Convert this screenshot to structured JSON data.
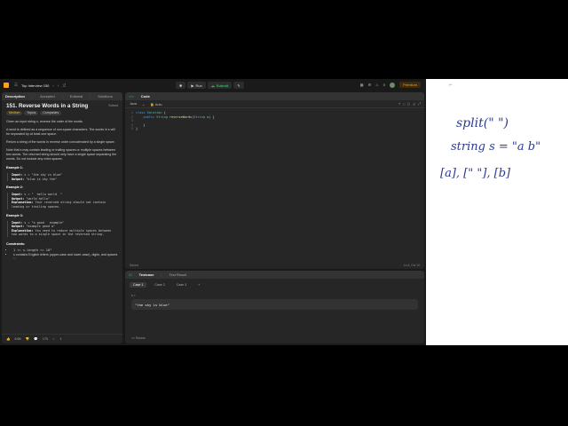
{
  "topbar": {
    "list_name": "Top Interview 150",
    "run_label": "Run",
    "submit_label": "Submit",
    "streak": "0",
    "premium_label": "Premium"
  },
  "desc_panel": {
    "tabs": [
      "Description",
      "Accepted",
      "Editorial",
      "Solutions"
    ],
    "title": "151. Reverse Words in a String",
    "solved": "Solved",
    "difficulty": "Medium",
    "topics": "Topics",
    "companies": "Companies",
    "p1": "Given an input string s, reverse the order of the words.",
    "p2": "A word is defined as a sequence of non-space characters. The words in s will be separated by at least one space.",
    "p3": "Return a string of the words in reverse order concatenated by a single space.",
    "p4": "Note that s may contain leading or trailing spaces or multiple spaces between two words. The returned string should only have a single space separating the words. Do not include any extra spaces.",
    "examples": [
      {
        "title": "Example 1:",
        "input": "s = \"the sky is blue\"",
        "output": "\"blue is sky the\"",
        "explanation": ""
      },
      {
        "title": "Example 2:",
        "input": "s = \"  hello world  \"",
        "output": "\"world hello\"",
        "explanation": "Your reversed string should not contain leading or trailing spaces."
      },
      {
        "title": "Example 3:",
        "input": "s = \"a good   example\"",
        "output": "\"example good a\"",
        "explanation": "You need to reduce multiple spaces between two words to a single space in the reversed string."
      }
    ],
    "input_key": "Input:",
    "output_key": "Output:",
    "explanation_key": "Explanation:",
    "constraints_title": "Constraints:",
    "constraints": [
      "1 <= s.length <= 10⁴",
      "s contains English letters (upper-case and lower-case), digits, and spaces ' '."
    ],
    "likes": "8.6K",
    "comments": "170"
  },
  "code_panel": {
    "title": "Code",
    "language": "Java",
    "autocomplete": "Auto",
    "lines": [
      "class Solution {",
      "    public String reverseWords(String s) {",
      "        ",
      "    }",
      "}"
    ],
    "saved": "Saved",
    "cursor": "Ln 4, Col 10"
  },
  "test_panel": {
    "tabs": [
      "Testcase",
      "Test Result"
    ],
    "cases": [
      "Case 1",
      "Case 2",
      "Case 3"
    ],
    "input_label": "s =",
    "input_value": "\"the sky is blue\"",
    "source": "Source"
  },
  "whiteboard": {
    "line1": "split(\"  \")",
    "line2": "string s = \"a  b\"",
    "line3": "[a], [\" \"], [b]"
  }
}
